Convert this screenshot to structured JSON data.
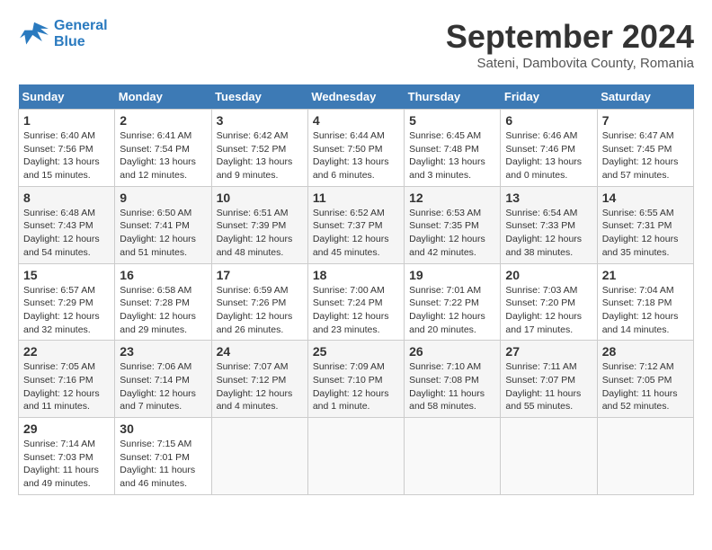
{
  "header": {
    "logo_line1": "General",
    "logo_line2": "Blue",
    "month_year": "September 2024",
    "location": "Sateni, Dambovita County, Romania"
  },
  "columns": [
    "Sunday",
    "Monday",
    "Tuesday",
    "Wednesday",
    "Thursday",
    "Friday",
    "Saturday"
  ],
  "weeks": [
    [
      {
        "day": "1",
        "info": "Sunrise: 6:40 AM\nSunset: 7:56 PM\nDaylight: 13 hours\nand 15 minutes."
      },
      {
        "day": "2",
        "info": "Sunrise: 6:41 AM\nSunset: 7:54 PM\nDaylight: 13 hours\nand 12 minutes."
      },
      {
        "day": "3",
        "info": "Sunrise: 6:42 AM\nSunset: 7:52 PM\nDaylight: 13 hours\nand 9 minutes."
      },
      {
        "day": "4",
        "info": "Sunrise: 6:44 AM\nSunset: 7:50 PM\nDaylight: 13 hours\nand 6 minutes."
      },
      {
        "day": "5",
        "info": "Sunrise: 6:45 AM\nSunset: 7:48 PM\nDaylight: 13 hours\nand 3 minutes."
      },
      {
        "day": "6",
        "info": "Sunrise: 6:46 AM\nSunset: 7:46 PM\nDaylight: 13 hours\nand 0 minutes."
      },
      {
        "day": "7",
        "info": "Sunrise: 6:47 AM\nSunset: 7:45 PM\nDaylight: 12 hours\nand 57 minutes."
      }
    ],
    [
      {
        "day": "8",
        "info": "Sunrise: 6:48 AM\nSunset: 7:43 PM\nDaylight: 12 hours\nand 54 minutes."
      },
      {
        "day": "9",
        "info": "Sunrise: 6:50 AM\nSunset: 7:41 PM\nDaylight: 12 hours\nand 51 minutes."
      },
      {
        "day": "10",
        "info": "Sunrise: 6:51 AM\nSunset: 7:39 PM\nDaylight: 12 hours\nand 48 minutes."
      },
      {
        "day": "11",
        "info": "Sunrise: 6:52 AM\nSunset: 7:37 PM\nDaylight: 12 hours\nand 45 minutes."
      },
      {
        "day": "12",
        "info": "Sunrise: 6:53 AM\nSunset: 7:35 PM\nDaylight: 12 hours\nand 42 minutes."
      },
      {
        "day": "13",
        "info": "Sunrise: 6:54 AM\nSunset: 7:33 PM\nDaylight: 12 hours\nand 38 minutes."
      },
      {
        "day": "14",
        "info": "Sunrise: 6:55 AM\nSunset: 7:31 PM\nDaylight: 12 hours\nand 35 minutes."
      }
    ],
    [
      {
        "day": "15",
        "info": "Sunrise: 6:57 AM\nSunset: 7:29 PM\nDaylight: 12 hours\nand 32 minutes."
      },
      {
        "day": "16",
        "info": "Sunrise: 6:58 AM\nSunset: 7:28 PM\nDaylight: 12 hours\nand 29 minutes."
      },
      {
        "day": "17",
        "info": "Sunrise: 6:59 AM\nSunset: 7:26 PM\nDaylight: 12 hours\nand 26 minutes."
      },
      {
        "day": "18",
        "info": "Sunrise: 7:00 AM\nSunset: 7:24 PM\nDaylight: 12 hours\nand 23 minutes."
      },
      {
        "day": "19",
        "info": "Sunrise: 7:01 AM\nSunset: 7:22 PM\nDaylight: 12 hours\nand 20 minutes."
      },
      {
        "day": "20",
        "info": "Sunrise: 7:03 AM\nSunset: 7:20 PM\nDaylight: 12 hours\nand 17 minutes."
      },
      {
        "day": "21",
        "info": "Sunrise: 7:04 AM\nSunset: 7:18 PM\nDaylight: 12 hours\nand 14 minutes."
      }
    ],
    [
      {
        "day": "22",
        "info": "Sunrise: 7:05 AM\nSunset: 7:16 PM\nDaylight: 12 hours\nand 11 minutes."
      },
      {
        "day": "23",
        "info": "Sunrise: 7:06 AM\nSunset: 7:14 PM\nDaylight: 12 hours\nand 7 minutes."
      },
      {
        "day": "24",
        "info": "Sunrise: 7:07 AM\nSunset: 7:12 PM\nDaylight: 12 hours\nand 4 minutes."
      },
      {
        "day": "25",
        "info": "Sunrise: 7:09 AM\nSunset: 7:10 PM\nDaylight: 12 hours\nand 1 minute."
      },
      {
        "day": "26",
        "info": "Sunrise: 7:10 AM\nSunset: 7:08 PM\nDaylight: 11 hours\nand 58 minutes."
      },
      {
        "day": "27",
        "info": "Sunrise: 7:11 AM\nSunset: 7:07 PM\nDaylight: 11 hours\nand 55 minutes."
      },
      {
        "day": "28",
        "info": "Sunrise: 7:12 AM\nSunset: 7:05 PM\nDaylight: 11 hours\nand 52 minutes."
      }
    ],
    [
      {
        "day": "29",
        "info": "Sunrise: 7:14 AM\nSunset: 7:03 PM\nDaylight: 11 hours\nand 49 minutes."
      },
      {
        "day": "30",
        "info": "Sunrise: 7:15 AM\nSunset: 7:01 PM\nDaylight: 11 hours\nand 46 minutes."
      },
      {
        "day": "",
        "info": ""
      },
      {
        "day": "",
        "info": ""
      },
      {
        "day": "",
        "info": ""
      },
      {
        "day": "",
        "info": ""
      },
      {
        "day": "",
        "info": ""
      }
    ]
  ]
}
